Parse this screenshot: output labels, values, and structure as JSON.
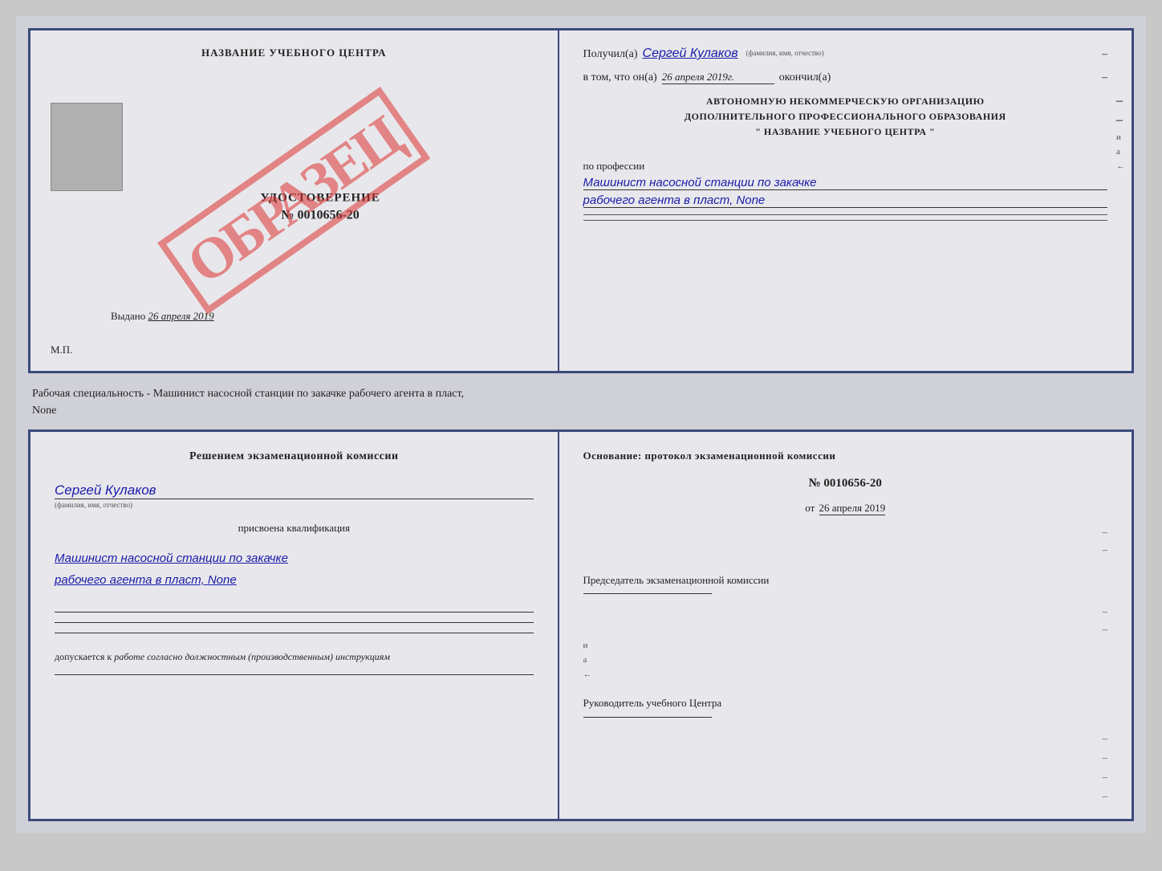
{
  "topDoc": {
    "left": {
      "centerTitle": "НАЗВАНИЕ УЧЕБНОГО ЦЕНТРА",
      "udostoverenie": "УДОСТОВЕРЕНИЕ",
      "nomer": "№ 0010656-20",
      "vydano": "Выдано",
      "vydanoDate": "26 апреля 2019",
      "mp": "М.П.",
      "obrazets": "ОБРАЗЕЦ"
    },
    "right": {
      "poluchilLabel": "Получил(а)",
      "poluchilValue": "Сергей Кулаков",
      "fioLabel": "(фамилия, имя, отчество)",
      "dash1": "–",
      "vtomLabel": "в том, что он(а)",
      "vtomDate": "26 апреля 2019г.",
      "okonchilLabel": "окончил(а)",
      "dash2": "–",
      "orgLine1": "АВТОНОМНУЮ НЕКОММЕРЧЕСКУЮ ОРГАНИЗАЦИЮ",
      "orgLine2": "ДОПОЛНИТЕЛЬНОГО ПРОФЕССИОНАЛЬНОГО ОБРАЗОВАНИЯ",
      "orgLine3": "\"  НАЗВАНИЕ УЧЕБНОГО ЦЕНТРА  \"",
      "dash3": "–",
      "iLabel": "и",
      "aLabel": "а",
      "leftArrow": "←",
      "professiiLabel": "по профессии",
      "professionLine1": "Машинист насосной станции по закачке",
      "professionLine2": "рабочего агента в пласт, None",
      "dash4": "–",
      "dash5": "–"
    }
  },
  "captionText": "Рабочая специальность - Машинист насосной станции по закачке рабочего агента в пласт,",
  "captionText2": "None",
  "bottomDoc": {
    "left": {
      "komissiaTitle": "Решением  экзаменационной  комиссии",
      "name": "Сергей Кулаков",
      "fioLabel": "(фамилия, имя, отчество)",
      "prisvoena": "присвоена квалификация",
      "qualification1": "Машинист насосной станции по закачке",
      "qualification2": "рабочего агента в пласт, None",
      "dopuskaetsya": "допускается к",
      "dopuskaetsyaItalic": "работе согласно должностным (производственным) инструкциям"
    },
    "right": {
      "osnovanie": "Основание: протокол экзаменационной  комиссии",
      "nomer": "№ 0010656-20",
      "ot": "от",
      "date": "26 апреля 2019",
      "dash1": "–",
      "dash2": "–",
      "predsedatel": "Председатель экзаменационной комиссии",
      "dash3": "–",
      "dash4": "–",
      "iLabel": "и",
      "aLabel": "а",
      "leftArrow": "←",
      "rukovoditel": "Руководитель учебного Центра",
      "dash5": "–",
      "dash6": "–",
      "dash7": "–",
      "dash8": "–"
    }
  }
}
